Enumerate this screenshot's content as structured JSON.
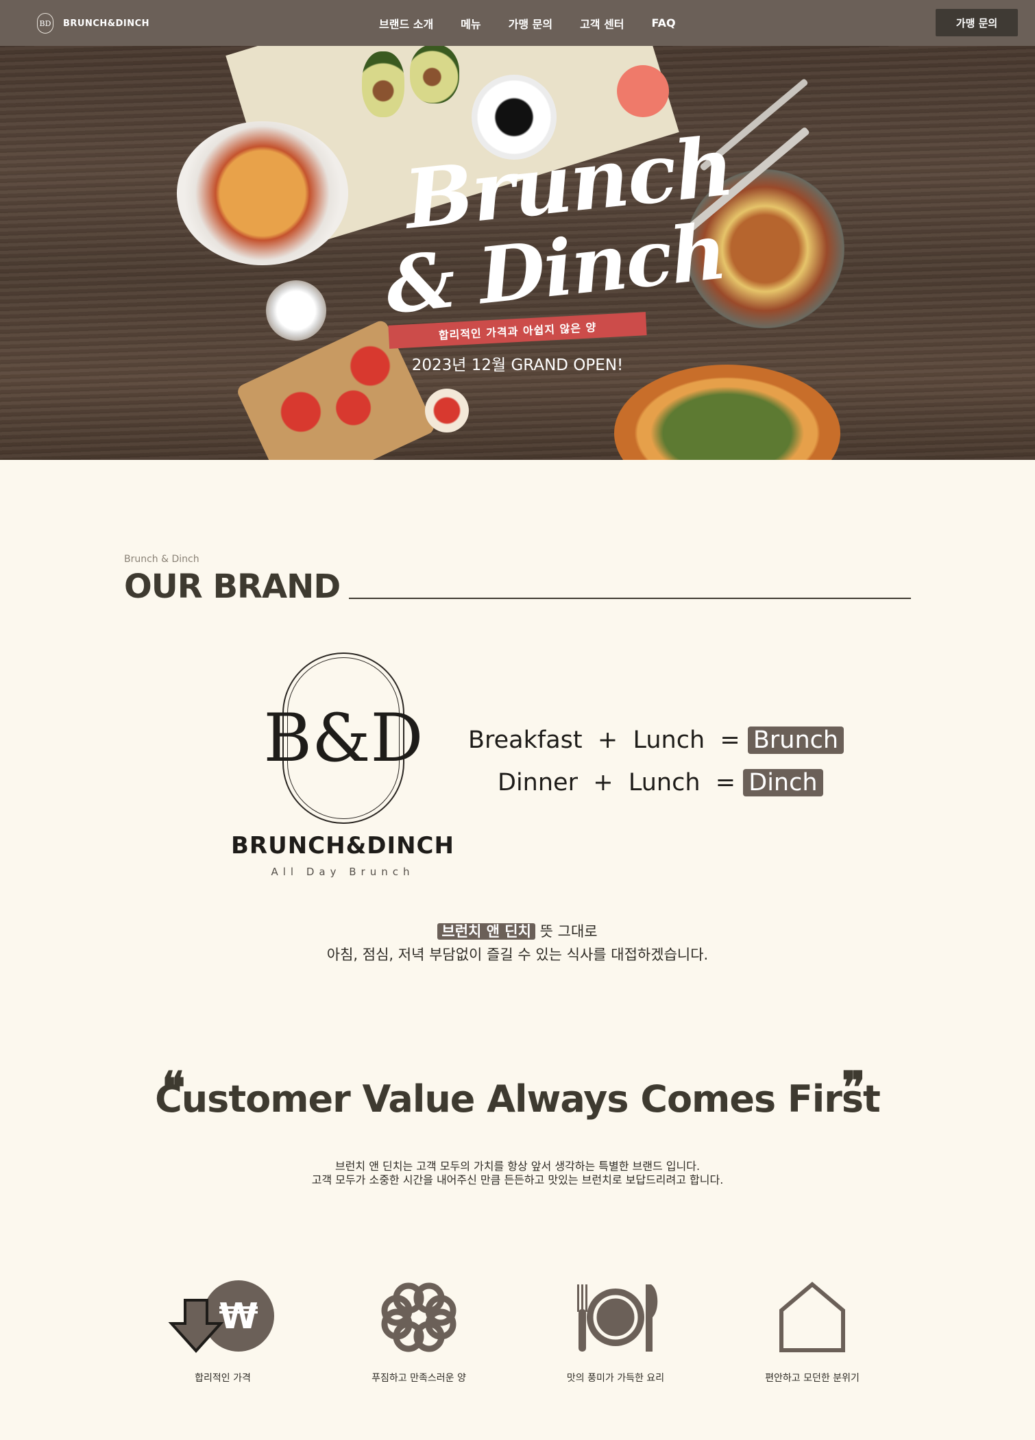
{
  "nav": {
    "logo_text": "BRUNCH&DINCH",
    "logo_monogram": "BD",
    "menu": [
      "브랜드 소개",
      "메뉴",
      "가맹 문의",
      "고객 센터",
      "FAQ"
    ],
    "cta_label": "가맹 문의"
  },
  "hero": {
    "title_line1": "Brunch",
    "title_line2": "& Dinch",
    "ribbon": "합리적인 가격과  아쉽지 않은 양",
    "opening": "2023년 12월 GRAND OPEN!",
    "slides": 2
  },
  "brand": {
    "eyebrow": "Brunch & Dinch",
    "heading": "OUR BRAND",
    "monogram": "B&D",
    "name": "BRUNCH&DINCH",
    "subtitle": "All Day Brunch",
    "eq1": {
      "a": "Breakfast",
      "op": "+",
      "b": "Lunch",
      "eq": "=",
      "result": "Brunch"
    },
    "eq2": {
      "a": "Dinner",
      "op": "+",
      "b": "Lunch",
      "eq": "=",
      "result": "Dinch"
    },
    "desc_highlight": "브런치 앤 딘치",
    "desc_rest": " 뜻 그대로",
    "desc_line2": "아침, 점심, 저녁 부담없이 즐길 수 있는 식사를 대접하겠습니다."
  },
  "value": {
    "open_quote": "❝",
    "close_quote": "❞",
    "title": "Customer Value Always Comes First",
    "desc_line1": "브런치 앤 딘치는 고객 모두의 가치를 항상 앞서 생각하는 특별한 브랜드 입니다.",
    "desc_line2": "고객 모두가 소중한 시간을 내어주신 만큼 든든하고 맛있는 브런치로 보답드리려고 합니다."
  },
  "features": [
    {
      "icon": "price-down-icon",
      "label": "합리적인 가격"
    },
    {
      "icon": "clover-icon",
      "label": "푸짐하고 만족스러운 양"
    },
    {
      "icon": "plate-utensils-icon",
      "label": "맛의 풍미가 가득한 요리"
    },
    {
      "icon": "house-icon",
      "label": "편안하고 모던한 분위기"
    }
  ],
  "colors": {
    "nav": "#6b6058",
    "accent": "#6b6058",
    "ribbon": "#cc4c4a",
    "background": "#fcf8ee",
    "text": "#3e3a30"
  }
}
